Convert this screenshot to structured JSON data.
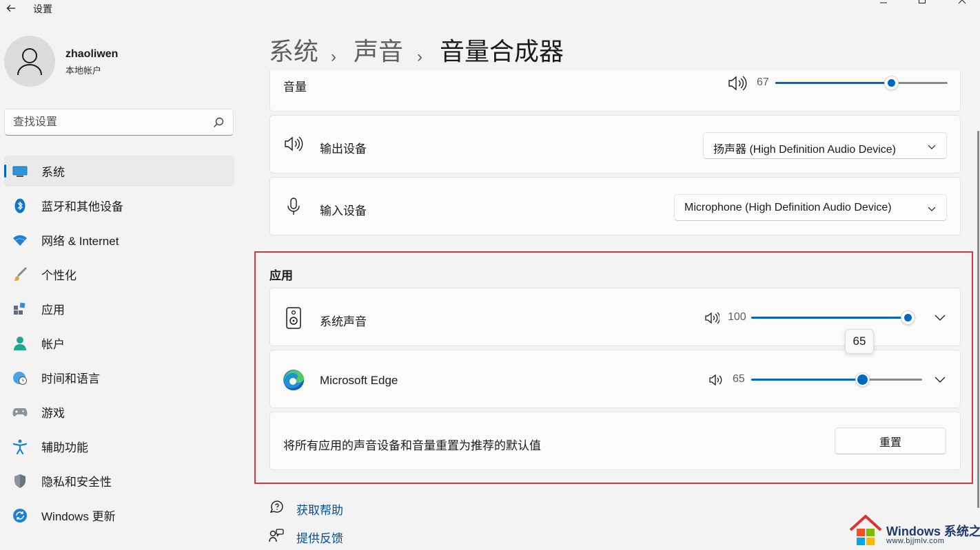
{
  "window": {
    "title": "设置",
    "controls": [
      "minimize",
      "maximize",
      "close"
    ]
  },
  "user": {
    "name": "zhaoliwen",
    "account_type": "本地帐户"
  },
  "search": {
    "placeholder": "查找设置",
    "value": ""
  },
  "sidebar": {
    "items": [
      {
        "label": "系统",
        "icon": "system-icon",
        "active": true
      },
      {
        "label": "蓝牙和其他设备",
        "icon": "bluetooth-icon"
      },
      {
        "label": "网络 & Internet",
        "icon": "wifi-icon"
      },
      {
        "label": "个性化",
        "icon": "brush-icon"
      },
      {
        "label": "应用",
        "icon": "apps-icon"
      },
      {
        "label": "帐户",
        "icon": "account-icon"
      },
      {
        "label": "时间和语言",
        "icon": "globe-clock-icon"
      },
      {
        "label": "游戏",
        "icon": "gamepad-icon"
      },
      {
        "label": "辅助功能",
        "icon": "accessibility-icon"
      },
      {
        "label": "隐私和安全性",
        "icon": "shield-icon"
      },
      {
        "label": "Windows 更新",
        "icon": "update-icon"
      }
    ]
  },
  "breadcrumb": [
    "系统",
    "声音",
    "音量合成器"
  ],
  "volume": {
    "label": "音量",
    "value": "67",
    "level": 67
  },
  "output_device": {
    "label": "输出设备",
    "selected": "扬声器 (High Definition Audio Device)"
  },
  "input_device": {
    "label": "输入设备",
    "selected": "Microphone (High Definition Audio Device)"
  },
  "apps": {
    "title": "应用",
    "items": [
      {
        "name": "系统声音",
        "icon": "system-sounds-icon",
        "value": "100",
        "level": 100
      },
      {
        "name": "Microsoft Edge",
        "icon": "edge-icon",
        "value": "65",
        "level": 65
      }
    ],
    "tooltip": "65",
    "reset_text": "将所有应用的声音设备和音量重置为推荐的默认值",
    "reset_button": "重置"
  },
  "footer": {
    "help": "获取帮助",
    "feedback": "提供反馈"
  },
  "watermark": {
    "brand": "Windows 系统之家",
    "url": "www.bjjmlv.com"
  },
  "colors": {
    "accent": "#0067c0",
    "highlight_border": "#d9383f",
    "link": "#0050a0"
  }
}
